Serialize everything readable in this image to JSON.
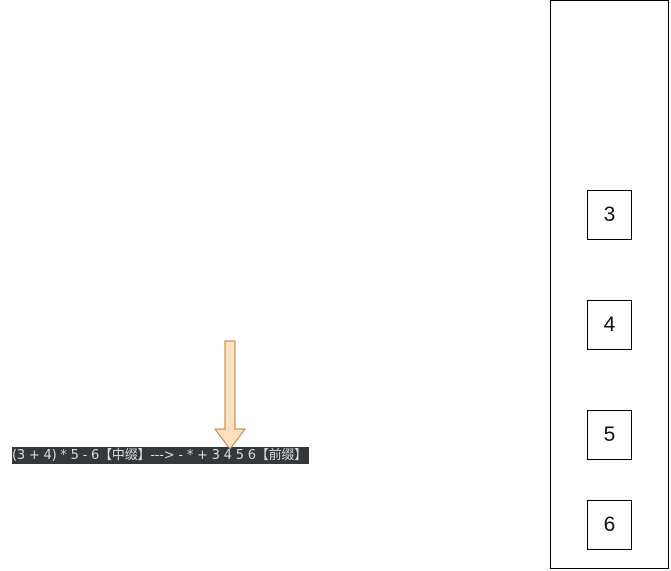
{
  "expression": {
    "text": "(3 + 4) * 5 - 6【中缀】---> - * + 3 4 5 6【前缀】"
  },
  "stack": {
    "items": [
      "3",
      "4",
      "5",
      "6"
    ]
  },
  "colors": {
    "arrow_fill": "#fde0c0",
    "arrow_stroke": "#b9813a",
    "label_background": "#34383b",
    "label_text": "#d9dadb"
  }
}
